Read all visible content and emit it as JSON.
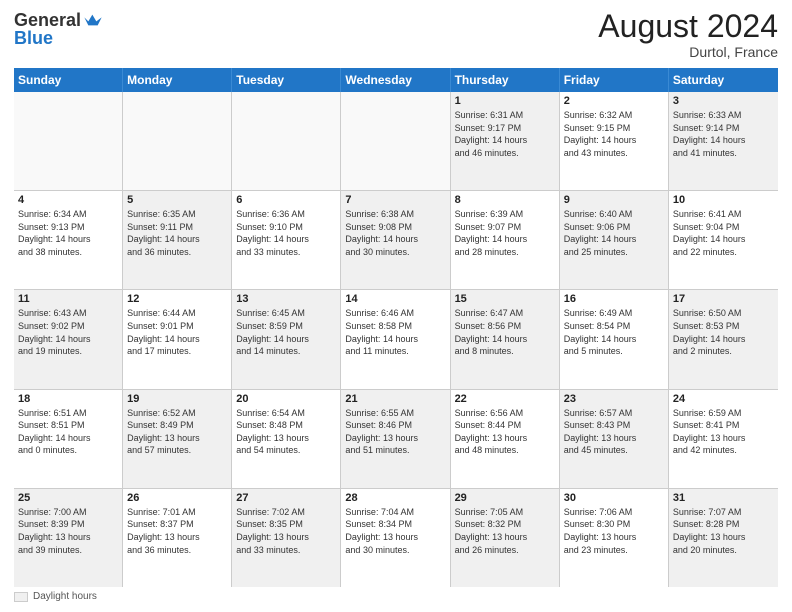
{
  "header": {
    "logo_general": "General",
    "logo_blue": "Blue",
    "month_title": "August 2024",
    "location": "Durtol, France"
  },
  "footer": {
    "daylight_label": "Daylight hours"
  },
  "weekdays": [
    "Sunday",
    "Monday",
    "Tuesday",
    "Wednesday",
    "Thursday",
    "Friday",
    "Saturday"
  ],
  "rows": [
    [
      {
        "day": "",
        "text": "",
        "empty": true
      },
      {
        "day": "",
        "text": "",
        "empty": true
      },
      {
        "day": "",
        "text": "",
        "empty": true
      },
      {
        "day": "",
        "text": "",
        "empty": true
      },
      {
        "day": "1",
        "text": "Sunrise: 6:31 AM\nSunset: 9:17 PM\nDaylight: 14 hours\nand 46 minutes.",
        "shaded": true
      },
      {
        "day": "2",
        "text": "Sunrise: 6:32 AM\nSunset: 9:15 PM\nDaylight: 14 hours\nand 43 minutes.",
        "shaded": false
      },
      {
        "day": "3",
        "text": "Sunrise: 6:33 AM\nSunset: 9:14 PM\nDaylight: 14 hours\nand 41 minutes.",
        "shaded": true
      }
    ],
    [
      {
        "day": "4",
        "text": "Sunrise: 6:34 AM\nSunset: 9:13 PM\nDaylight: 14 hours\nand 38 minutes.",
        "shaded": false
      },
      {
        "day": "5",
        "text": "Sunrise: 6:35 AM\nSunset: 9:11 PM\nDaylight: 14 hours\nand 36 minutes.",
        "shaded": true
      },
      {
        "day": "6",
        "text": "Sunrise: 6:36 AM\nSunset: 9:10 PM\nDaylight: 14 hours\nand 33 minutes.",
        "shaded": false
      },
      {
        "day": "7",
        "text": "Sunrise: 6:38 AM\nSunset: 9:08 PM\nDaylight: 14 hours\nand 30 minutes.",
        "shaded": true
      },
      {
        "day": "8",
        "text": "Sunrise: 6:39 AM\nSunset: 9:07 PM\nDaylight: 14 hours\nand 28 minutes.",
        "shaded": false
      },
      {
        "day": "9",
        "text": "Sunrise: 6:40 AM\nSunset: 9:06 PM\nDaylight: 14 hours\nand 25 minutes.",
        "shaded": true
      },
      {
        "day": "10",
        "text": "Sunrise: 6:41 AM\nSunset: 9:04 PM\nDaylight: 14 hours\nand 22 minutes.",
        "shaded": false
      }
    ],
    [
      {
        "day": "11",
        "text": "Sunrise: 6:43 AM\nSunset: 9:02 PM\nDaylight: 14 hours\nand 19 minutes.",
        "shaded": true
      },
      {
        "day": "12",
        "text": "Sunrise: 6:44 AM\nSunset: 9:01 PM\nDaylight: 14 hours\nand 17 minutes.",
        "shaded": false
      },
      {
        "day": "13",
        "text": "Sunrise: 6:45 AM\nSunset: 8:59 PM\nDaylight: 14 hours\nand 14 minutes.",
        "shaded": true
      },
      {
        "day": "14",
        "text": "Sunrise: 6:46 AM\nSunset: 8:58 PM\nDaylight: 14 hours\nand 11 minutes.",
        "shaded": false
      },
      {
        "day": "15",
        "text": "Sunrise: 6:47 AM\nSunset: 8:56 PM\nDaylight: 14 hours\nand 8 minutes.",
        "shaded": true
      },
      {
        "day": "16",
        "text": "Sunrise: 6:49 AM\nSunset: 8:54 PM\nDaylight: 14 hours\nand 5 minutes.",
        "shaded": false
      },
      {
        "day": "17",
        "text": "Sunrise: 6:50 AM\nSunset: 8:53 PM\nDaylight: 14 hours\nand 2 minutes.",
        "shaded": true
      }
    ],
    [
      {
        "day": "18",
        "text": "Sunrise: 6:51 AM\nSunset: 8:51 PM\nDaylight: 14 hours\nand 0 minutes.",
        "shaded": false
      },
      {
        "day": "19",
        "text": "Sunrise: 6:52 AM\nSunset: 8:49 PM\nDaylight: 13 hours\nand 57 minutes.",
        "shaded": true
      },
      {
        "day": "20",
        "text": "Sunrise: 6:54 AM\nSunset: 8:48 PM\nDaylight: 13 hours\nand 54 minutes.",
        "shaded": false
      },
      {
        "day": "21",
        "text": "Sunrise: 6:55 AM\nSunset: 8:46 PM\nDaylight: 13 hours\nand 51 minutes.",
        "shaded": true
      },
      {
        "day": "22",
        "text": "Sunrise: 6:56 AM\nSunset: 8:44 PM\nDaylight: 13 hours\nand 48 minutes.",
        "shaded": false
      },
      {
        "day": "23",
        "text": "Sunrise: 6:57 AM\nSunset: 8:43 PM\nDaylight: 13 hours\nand 45 minutes.",
        "shaded": true
      },
      {
        "day": "24",
        "text": "Sunrise: 6:59 AM\nSunset: 8:41 PM\nDaylight: 13 hours\nand 42 minutes.",
        "shaded": false
      }
    ],
    [
      {
        "day": "25",
        "text": "Sunrise: 7:00 AM\nSunset: 8:39 PM\nDaylight: 13 hours\nand 39 minutes.",
        "shaded": true
      },
      {
        "day": "26",
        "text": "Sunrise: 7:01 AM\nSunset: 8:37 PM\nDaylight: 13 hours\nand 36 minutes.",
        "shaded": false
      },
      {
        "day": "27",
        "text": "Sunrise: 7:02 AM\nSunset: 8:35 PM\nDaylight: 13 hours\nand 33 minutes.",
        "shaded": true
      },
      {
        "day": "28",
        "text": "Sunrise: 7:04 AM\nSunset: 8:34 PM\nDaylight: 13 hours\nand 30 minutes.",
        "shaded": false
      },
      {
        "day": "29",
        "text": "Sunrise: 7:05 AM\nSunset: 8:32 PM\nDaylight: 13 hours\nand 26 minutes.",
        "shaded": true
      },
      {
        "day": "30",
        "text": "Sunrise: 7:06 AM\nSunset: 8:30 PM\nDaylight: 13 hours\nand 23 minutes.",
        "shaded": false
      },
      {
        "day": "31",
        "text": "Sunrise: 7:07 AM\nSunset: 8:28 PM\nDaylight: 13 hours\nand 20 minutes.",
        "shaded": true
      }
    ]
  ]
}
